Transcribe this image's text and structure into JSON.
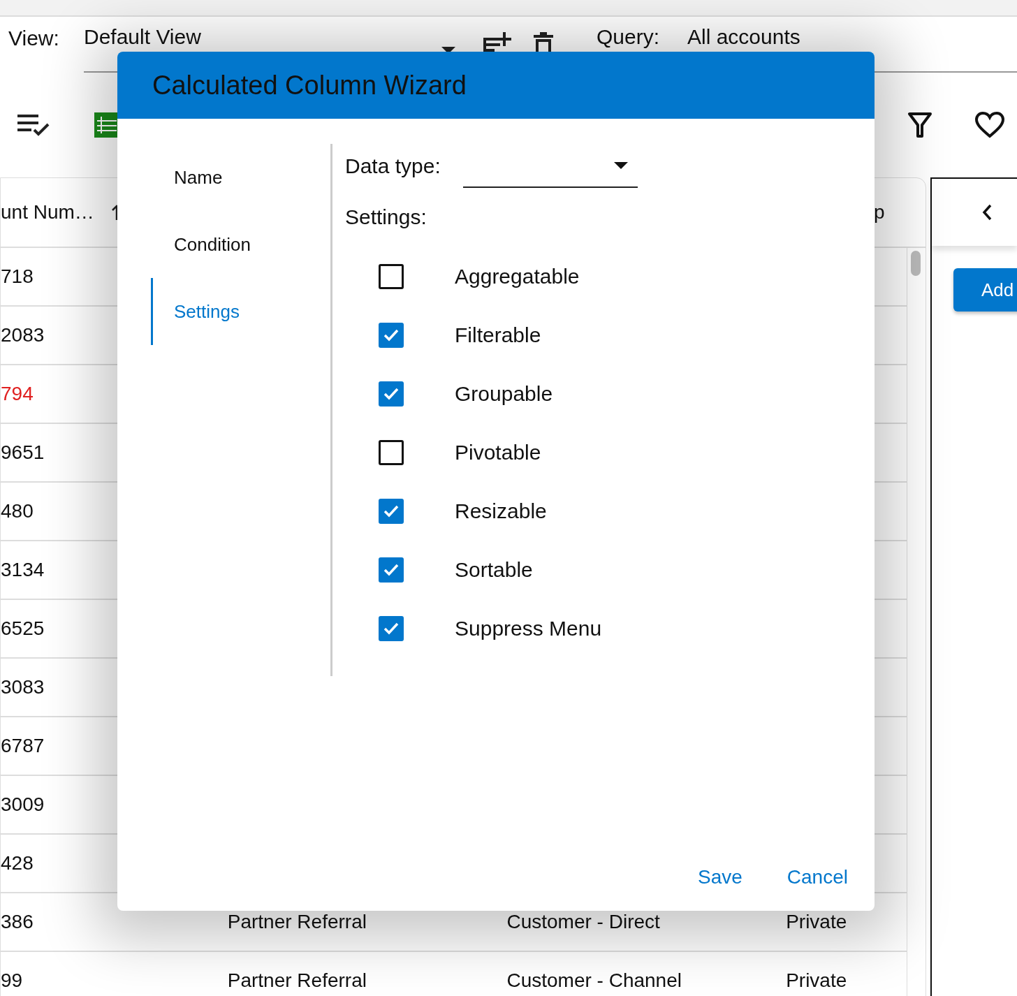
{
  "toolbar": {
    "view_label": "View:",
    "view_value": "Default View",
    "query_label": "Query:",
    "query_value": "All accounts"
  },
  "grid": {
    "header_1": "unt Num…",
    "header_4": "p",
    "rows": [
      {
        "column_1": "718",
        "alert": false
      },
      {
        "column_1": "2083",
        "alert": false
      },
      {
        "column_1": "794",
        "alert": true
      },
      {
        "column_1": "9651",
        "alert": false
      },
      {
        "column_1": "480",
        "alert": false
      },
      {
        "column_1": "3134",
        "alert": false
      },
      {
        "column_1": "6525",
        "alert": false
      },
      {
        "column_1": "3083",
        "alert": false
      },
      {
        "column_1": "6787",
        "alert": false
      },
      {
        "column_1": "3009",
        "alert": false
      },
      {
        "column_1": "428",
        "alert": false
      },
      {
        "column_1": "386",
        "alert": false,
        "column_2": "Partner Referral",
        "column_3": "Customer - Direct",
        "column_4": "Private"
      },
      {
        "column_1": "99",
        "alert": false,
        "column_2": "Partner Referral",
        "column_3": "Customer - Channel",
        "column_4": "Private"
      }
    ]
  },
  "side_panel": {
    "add_button": "Add"
  },
  "dialog": {
    "title": "Calculated Column Wizard",
    "steps": [
      {
        "label": "Name",
        "selected": false
      },
      {
        "label": "Condition",
        "selected": false
      },
      {
        "label": "Settings",
        "selected": true
      }
    ],
    "data_type_label": "Data type:",
    "settings_label": "Settings:",
    "settings": [
      {
        "label": "Aggregatable",
        "checked": false
      },
      {
        "label": "Filterable",
        "checked": true
      },
      {
        "label": "Groupable",
        "checked": true
      },
      {
        "label": "Pivotable",
        "checked": false
      },
      {
        "label": "Resizable",
        "checked": true
      },
      {
        "label": "Sortable",
        "checked": true
      },
      {
        "label": "Suppress Menu",
        "checked": true
      }
    ],
    "buttons": [
      "Save",
      "Cancel"
    ]
  }
}
